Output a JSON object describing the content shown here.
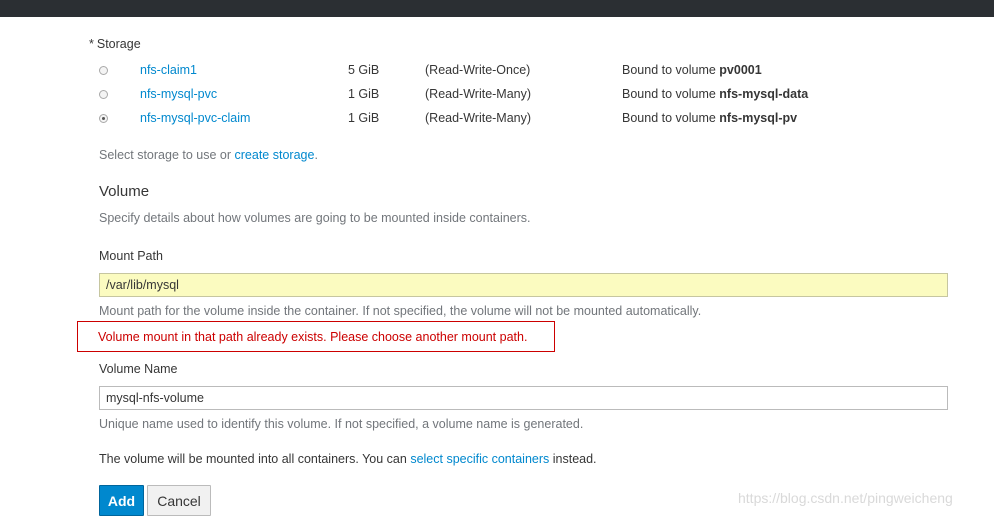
{
  "storage": {
    "label": "Storage",
    "required_marker": "*",
    "claims": [
      {
        "name": "nfs-claim1",
        "size": "5 GiB",
        "mode": "(Read-Write-Once)",
        "bound_prefix": "Bound to volume",
        "volume": "pv0001",
        "selected": false
      },
      {
        "name": "nfs-mysql-pvc",
        "size": "1 GiB",
        "mode": "(Read-Write-Many)",
        "bound_prefix": "Bound to volume",
        "volume": "nfs-mysql-data",
        "selected": false
      },
      {
        "name": "nfs-mysql-pvc-claim",
        "size": "1 GiB",
        "mode": "(Read-Write-Many)",
        "bound_prefix": "Bound to volume",
        "volume": "nfs-mysql-pv",
        "selected": true
      }
    ],
    "help_prefix": "Select storage to use or",
    "help_link": "create storage",
    "help_suffix": "."
  },
  "volume": {
    "heading": "Volume",
    "description": "Specify details about how volumes are going to be mounted inside containers."
  },
  "mount_path": {
    "label": "Mount Path",
    "value": "/var/lib/mysql",
    "help": "Mount path for the volume inside the container. If not specified, the volume will not be mounted automatically.",
    "error": "Volume mount in that path already exists. Please choose another mount path."
  },
  "volume_name": {
    "label": "Volume Name",
    "value": "mysql-nfs-volume",
    "help": "Unique name used to identify this volume. If not specified, a volume name is generated."
  },
  "containers_note": {
    "prefix": "The volume will be mounted into all containers. You can",
    "link": "select specific containers",
    "suffix": "instead."
  },
  "buttons": {
    "add": "Add",
    "cancel": "Cancel"
  },
  "watermark": "https://blog.csdn.net/pingweicheng",
  "colors": {
    "link": "#0088ce",
    "error": "#cc0000",
    "primary": "#0088ce",
    "topbar": "#2b2f33"
  }
}
